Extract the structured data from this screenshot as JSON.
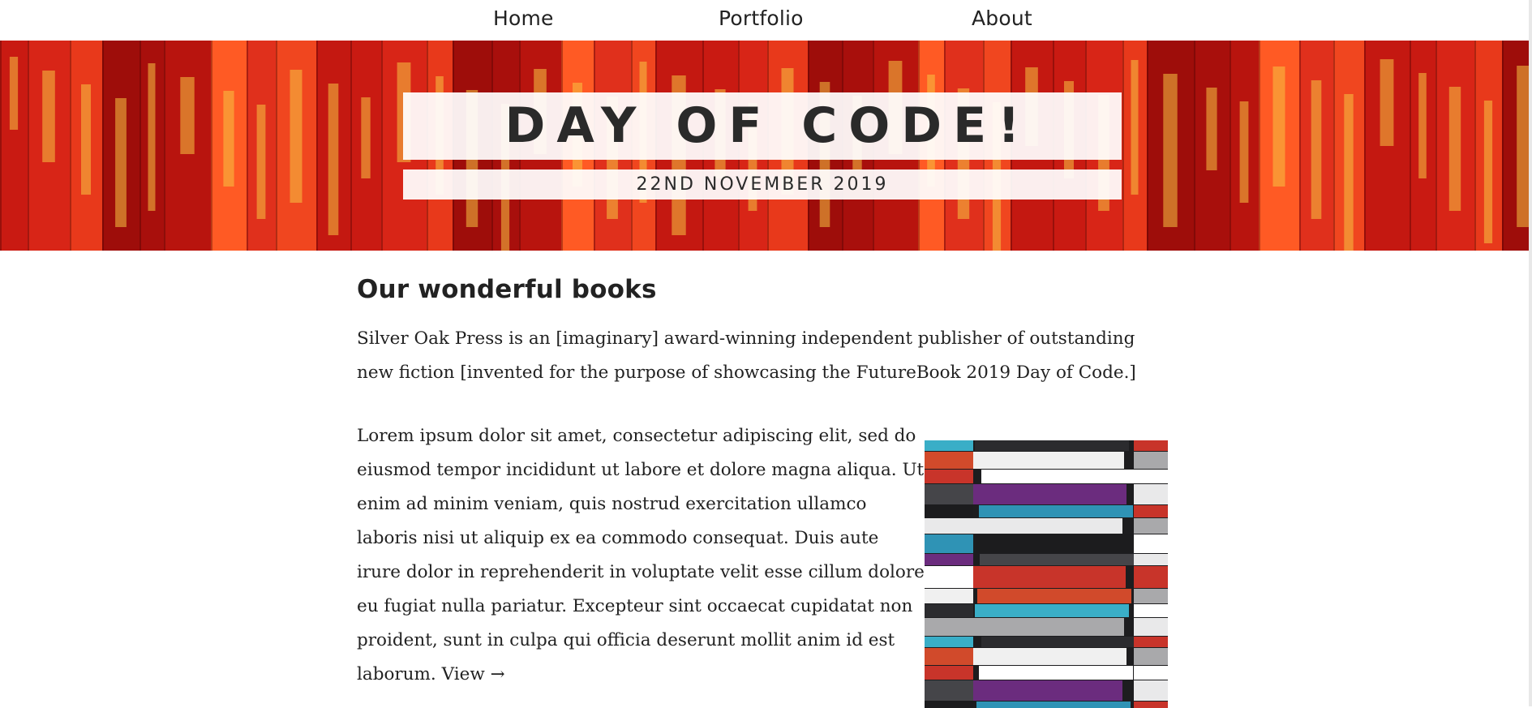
{
  "nav": {
    "home": "Home",
    "portfolio": "Portfolio",
    "about": "About"
  },
  "hero": {
    "title": "DAY OF CODE!",
    "date": "22ND NOVEMBER 2019",
    "spine_colors": [
      "#c91a12",
      "#e0301c",
      "#a80f0c",
      "#d82517",
      "#f0461f",
      "#b8140e",
      "#e8391b",
      "#c41811",
      "#ff5a24",
      "#9e0d0a"
    ],
    "spine_text_color": "#f5c542"
  },
  "main": {
    "heading": "Our wonderful books",
    "intro": "Silver Oak Press is an [imaginary] award-winning independent publisher of outstanding new fiction [invented for the purpose of showcasing the FutureBook 2019 Day of Code.]",
    "lorem": "Lorem ipsum dolor sit amet, consectetur adipiscing elit, sed do eiusmod tempor incididunt ut labore et dolore magna aliqua. Ut enim ad minim veniam, quis nostrud exercitation ullamco laboris nisi ut aliquip ex ea commodo consequat. Duis aute irure dolor in reprehenderit in voluptate velit esse cillum dolore eu fugiat nulla pariatur. Excepteur sint occaecat cupidatat non proident, sunt in culpa qui officia deserunt mollit anim id est laborum.",
    "view_link": "View →"
  },
  "photo": {
    "colors": [
      "#2b2b2e",
      "#e9e9ea",
      "#3aaec7",
      "#6b2c7e",
      "#c8342a",
      "#f0f0f0",
      "#1c1c1e",
      "#a9a9ab",
      "#2f93b5",
      "#d14a2b",
      "#ffffff",
      "#454549"
    ]
  }
}
